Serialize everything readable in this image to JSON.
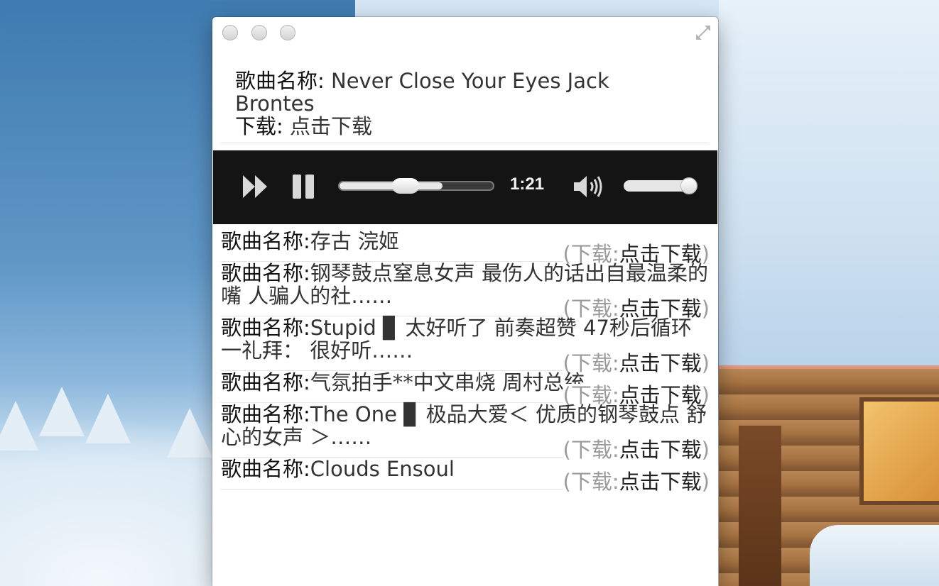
{
  "now_playing": {
    "title_label": "歌曲名称:",
    "title": "Never Close Your Eyes Jack Brontes",
    "download_label": "下载:",
    "download_link": "点击下载"
  },
  "player": {
    "time": "1:21",
    "progress_fraction": 0.43,
    "volume_fraction": 0.9
  },
  "playlist": {
    "title_label": "歌曲名称:",
    "download_open": "(",
    "download_label": "下载:",
    "download_link": "点击下载",
    "download_close": ")",
    "items": [
      {
        "title": "存古 浣姬"
      },
      {
        "title": "钢琴鼓点窒息女声 最伤人的话出自最温柔的嘴 人骗人的社……"
      },
      {
        "title": "Stupid ▊ 太好听了 前奏超赞 47秒后循环一礼拜： 很好听……"
      },
      {
        "title": "气氛拍手**中文串烧 周村总统"
      },
      {
        "title": "The One ▊  极品大爱＜ 优质的钢琴鼓点 舒心的女声 ＞……"
      },
      {
        "title": "Clouds Ensoul"
      }
    ]
  },
  "icons": {
    "fast_forward": "fast-forward-icon",
    "pause": "pause-icon",
    "volume": "volume-icon",
    "fullscreen": "fullscreen-icon"
  }
}
